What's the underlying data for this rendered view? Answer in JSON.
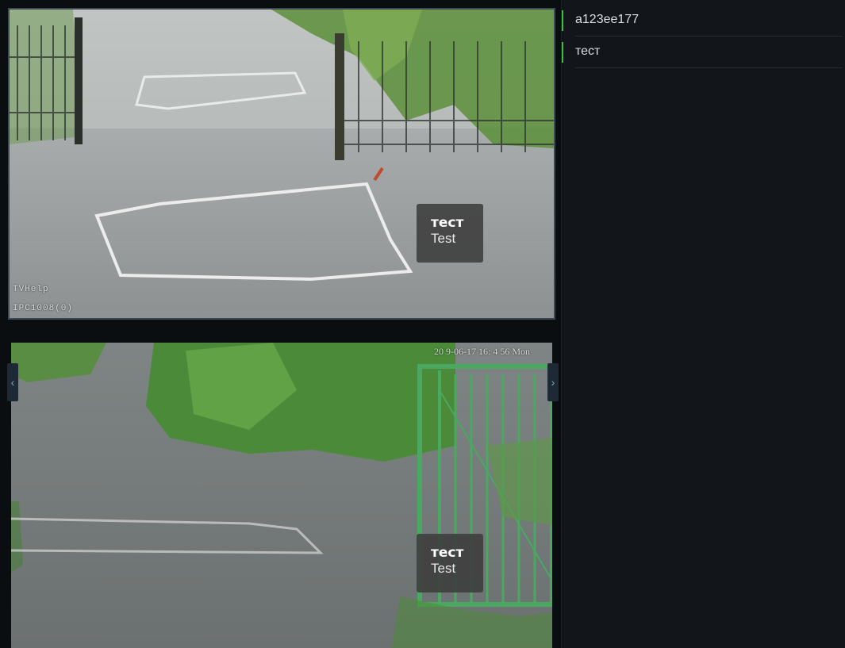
{
  "cameras": [
    {
      "osd_top": [
        "",
        ""
      ],
      "osd_line1": "TVHelp",
      "osd_line2": "IPC1008(0)",
      "tag": {
        "title": "тест",
        "subtitle": "Test"
      }
    },
    {
      "datetime": "20 9-06-17 16: 4 56 Mon",
      "tag": {
        "title": "тест",
        "subtitle": "Test"
      }
    }
  ],
  "nav": {
    "prev_icon": "‹",
    "next_icon": "›"
  },
  "sidebar": {
    "items": [
      {
        "label": "a123ee177"
      },
      {
        "label": "тест"
      }
    ]
  },
  "colors": {
    "accent": "#3fbf3f",
    "sidebar_bg": "#12161a",
    "video_bg": "#0b0e11"
  }
}
